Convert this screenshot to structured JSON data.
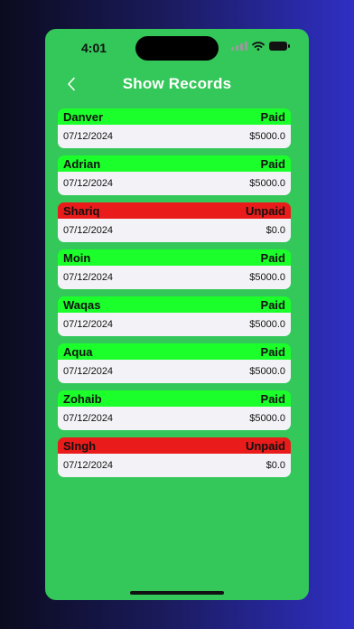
{
  "status_bar": {
    "time": "4:01"
  },
  "nav": {
    "title": "Show Records"
  },
  "records": [
    {
      "name": "Danver",
      "status": "Paid",
      "date": "07/12/2024",
      "amount": "$5000.0"
    },
    {
      "name": "Adrian",
      "status": "Paid",
      "date": "07/12/2024",
      "amount": "$5000.0"
    },
    {
      "name": "Shariq",
      "status": "Unpaid",
      "date": "07/12/2024",
      "amount": "$0.0"
    },
    {
      "name": "Moin",
      "status": "Paid",
      "date": "07/12/2024",
      "amount": "$5000.0"
    },
    {
      "name": "Waqas",
      "status": "Paid",
      "date": "07/12/2024",
      "amount": "$5000.0"
    },
    {
      "name": "Aqua",
      "status": "Paid",
      "date": "07/12/2024",
      "amount": "$5000.0"
    },
    {
      "name": "Zohaib",
      "status": "Paid",
      "date": "07/12/2024",
      "amount": "$5000.0"
    },
    {
      "name": "SIngh",
      "status": "Unpaid",
      "date": "07/12/2024",
      "amount": "$0.0"
    }
  ],
  "colors": {
    "screen_background": "#34c759",
    "paid_header": "#1bff2b",
    "unpaid_header": "#ea1b1b",
    "row_background": "#f3f3f7"
  },
  "icons": {
    "back": "chevron-left-icon",
    "signal": "cellular-signal-icon",
    "wifi": "wifi-icon",
    "battery": "battery-icon"
  }
}
